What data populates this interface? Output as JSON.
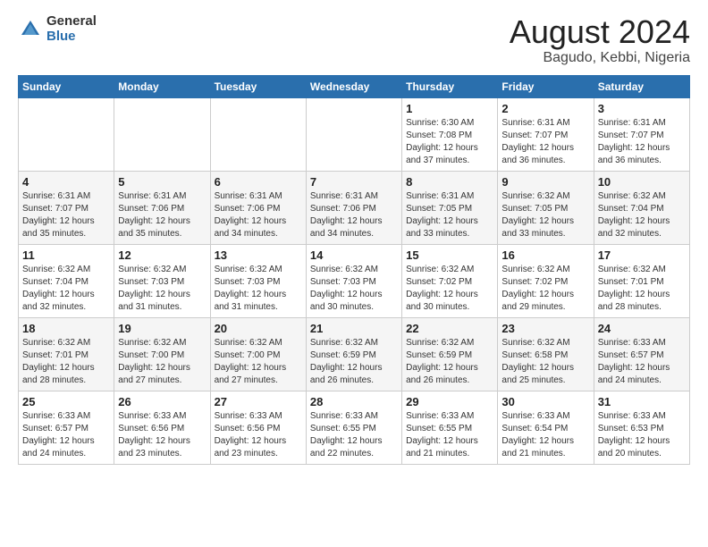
{
  "logo": {
    "general": "General",
    "blue": "Blue"
  },
  "title": "August 2024",
  "location": "Bagudo, Kebbi, Nigeria",
  "days_of_week": [
    "Sunday",
    "Monday",
    "Tuesday",
    "Wednesday",
    "Thursday",
    "Friday",
    "Saturday"
  ],
  "weeks": [
    [
      {
        "day": "",
        "info": ""
      },
      {
        "day": "",
        "info": ""
      },
      {
        "day": "",
        "info": ""
      },
      {
        "day": "",
        "info": ""
      },
      {
        "day": "1",
        "info": "Sunrise: 6:30 AM\nSunset: 7:08 PM\nDaylight: 12 hours\nand 37 minutes."
      },
      {
        "day": "2",
        "info": "Sunrise: 6:31 AM\nSunset: 7:07 PM\nDaylight: 12 hours\nand 36 minutes."
      },
      {
        "day": "3",
        "info": "Sunrise: 6:31 AM\nSunset: 7:07 PM\nDaylight: 12 hours\nand 36 minutes."
      }
    ],
    [
      {
        "day": "4",
        "info": "Sunrise: 6:31 AM\nSunset: 7:07 PM\nDaylight: 12 hours\nand 35 minutes."
      },
      {
        "day": "5",
        "info": "Sunrise: 6:31 AM\nSunset: 7:06 PM\nDaylight: 12 hours\nand 35 minutes."
      },
      {
        "day": "6",
        "info": "Sunrise: 6:31 AM\nSunset: 7:06 PM\nDaylight: 12 hours\nand 34 minutes."
      },
      {
        "day": "7",
        "info": "Sunrise: 6:31 AM\nSunset: 7:06 PM\nDaylight: 12 hours\nand 34 minutes."
      },
      {
        "day": "8",
        "info": "Sunrise: 6:31 AM\nSunset: 7:05 PM\nDaylight: 12 hours\nand 33 minutes."
      },
      {
        "day": "9",
        "info": "Sunrise: 6:32 AM\nSunset: 7:05 PM\nDaylight: 12 hours\nand 33 minutes."
      },
      {
        "day": "10",
        "info": "Sunrise: 6:32 AM\nSunset: 7:04 PM\nDaylight: 12 hours\nand 32 minutes."
      }
    ],
    [
      {
        "day": "11",
        "info": "Sunrise: 6:32 AM\nSunset: 7:04 PM\nDaylight: 12 hours\nand 32 minutes."
      },
      {
        "day": "12",
        "info": "Sunrise: 6:32 AM\nSunset: 7:03 PM\nDaylight: 12 hours\nand 31 minutes."
      },
      {
        "day": "13",
        "info": "Sunrise: 6:32 AM\nSunset: 7:03 PM\nDaylight: 12 hours\nand 31 minutes."
      },
      {
        "day": "14",
        "info": "Sunrise: 6:32 AM\nSunset: 7:03 PM\nDaylight: 12 hours\nand 30 minutes."
      },
      {
        "day": "15",
        "info": "Sunrise: 6:32 AM\nSunset: 7:02 PM\nDaylight: 12 hours\nand 30 minutes."
      },
      {
        "day": "16",
        "info": "Sunrise: 6:32 AM\nSunset: 7:02 PM\nDaylight: 12 hours\nand 29 minutes."
      },
      {
        "day": "17",
        "info": "Sunrise: 6:32 AM\nSunset: 7:01 PM\nDaylight: 12 hours\nand 28 minutes."
      }
    ],
    [
      {
        "day": "18",
        "info": "Sunrise: 6:32 AM\nSunset: 7:01 PM\nDaylight: 12 hours\nand 28 minutes."
      },
      {
        "day": "19",
        "info": "Sunrise: 6:32 AM\nSunset: 7:00 PM\nDaylight: 12 hours\nand 27 minutes."
      },
      {
        "day": "20",
        "info": "Sunrise: 6:32 AM\nSunset: 7:00 PM\nDaylight: 12 hours\nand 27 minutes."
      },
      {
        "day": "21",
        "info": "Sunrise: 6:32 AM\nSunset: 6:59 PM\nDaylight: 12 hours\nand 26 minutes."
      },
      {
        "day": "22",
        "info": "Sunrise: 6:32 AM\nSunset: 6:59 PM\nDaylight: 12 hours\nand 26 minutes."
      },
      {
        "day": "23",
        "info": "Sunrise: 6:32 AM\nSunset: 6:58 PM\nDaylight: 12 hours\nand 25 minutes."
      },
      {
        "day": "24",
        "info": "Sunrise: 6:33 AM\nSunset: 6:57 PM\nDaylight: 12 hours\nand 24 minutes."
      }
    ],
    [
      {
        "day": "25",
        "info": "Sunrise: 6:33 AM\nSunset: 6:57 PM\nDaylight: 12 hours\nand 24 minutes."
      },
      {
        "day": "26",
        "info": "Sunrise: 6:33 AM\nSunset: 6:56 PM\nDaylight: 12 hours\nand 23 minutes."
      },
      {
        "day": "27",
        "info": "Sunrise: 6:33 AM\nSunset: 6:56 PM\nDaylight: 12 hours\nand 23 minutes."
      },
      {
        "day": "28",
        "info": "Sunrise: 6:33 AM\nSunset: 6:55 PM\nDaylight: 12 hours\nand 22 minutes."
      },
      {
        "day": "29",
        "info": "Sunrise: 6:33 AM\nSunset: 6:55 PM\nDaylight: 12 hours\nand 21 minutes."
      },
      {
        "day": "30",
        "info": "Sunrise: 6:33 AM\nSunset: 6:54 PM\nDaylight: 12 hours\nand 21 minutes."
      },
      {
        "day": "31",
        "info": "Sunrise: 6:33 AM\nSunset: 6:53 PM\nDaylight: 12 hours\nand 20 minutes."
      }
    ]
  ]
}
